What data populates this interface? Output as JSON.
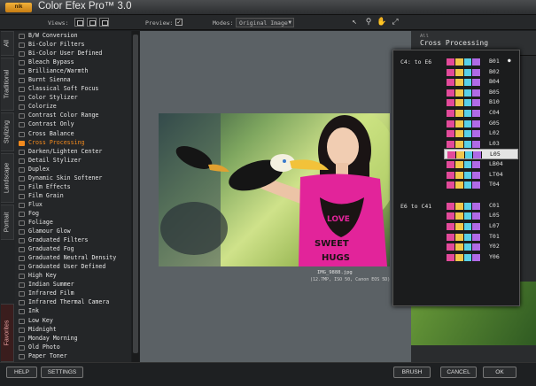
{
  "app": {
    "logo_text": "nik",
    "title": "Color Efex Pro™ 3.0"
  },
  "toolbar": {
    "views_label": "Views:",
    "preview_label": "Preview:",
    "preview_checked": true,
    "modes_label": "Modes:",
    "modes_value": "Original Image"
  },
  "side_tabs": [
    "All",
    "Traditional",
    "Stylizing",
    "Landscape",
    "Portrait",
    "Favorites"
  ],
  "filters": [
    "B/W Conversion",
    "Bi-Color Filters",
    "Bi-Color User Defined",
    "Bleach Bypass",
    "Brilliance/Warmth",
    "Burnt Sienna",
    "Classical Soft Focus",
    "Color Stylizer",
    "Colorize",
    "Contrast Color Range",
    "Contrast Only",
    "Cross Balance",
    "Cross Processing",
    "Darken/Lighten Center",
    "Detail Stylizer",
    "Duplex",
    "Dynamic Skin Softener",
    "Film Effects",
    "Film Grain",
    "Flux",
    "Fog",
    "Foliage",
    "Glamour Glow",
    "Graduated Filters",
    "Graduated Fog",
    "Graduated Neutral Density",
    "Graduated User Defined",
    "High Key",
    "Indian Summer",
    "Infrared Film",
    "Infrared Thermal Camera",
    "Ink",
    "Low Key",
    "Midnight",
    "Monday Morning",
    "Old Photo",
    "Paper Toner"
  ],
  "selected_filter": "Cross Processing",
  "preview": {
    "filename": "IMG_9888.jpg",
    "info": "(12.7MP, ISO 50, Canon EOS 5D)"
  },
  "right_panel": {
    "breadcrumb": "All",
    "title": "Cross Processing"
  },
  "preset_groups": [
    {
      "label": "C4: to E6",
      "presets": [
        "B01",
        "B02",
        "B04",
        "B05",
        "B10",
        "C04",
        "G05",
        "L02",
        "L03",
        "L05",
        "LB04",
        "LT04",
        "T04"
      ]
    },
    {
      "label": "E6 to C41",
      "presets": [
        "C01",
        "L05",
        "L07",
        "T01",
        "Y02",
        "Y06"
      ]
    }
  ],
  "selected_preset": "L05",
  "checked_preset": "B01",
  "colors": {
    "accent": "#f28a1e",
    "thumb_swatches": [
      "#e24a9a",
      "#f2c64a",
      "#5ad0e6",
      "#b06ae6"
    ]
  },
  "bottom": {
    "help": "HELP",
    "settings": "SETTINGS",
    "brush": "BRUSH",
    "cancel": "CANCEL",
    "ok": "OK"
  }
}
